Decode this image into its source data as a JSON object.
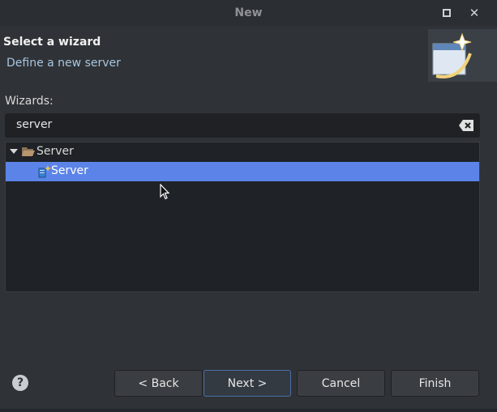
{
  "window": {
    "title": "New"
  },
  "header": {
    "heading": "Select a wizard",
    "subtitle": "Define a new server"
  },
  "wizards": {
    "label": "Wizards:",
    "search_value": "server",
    "tree": [
      {
        "label": "Server",
        "type": "folder",
        "expanded": true
      },
      {
        "label": "Server",
        "type": "server",
        "selected": true
      }
    ]
  },
  "buttons": {
    "back": "< Back",
    "next": "Next >",
    "cancel": "Cancel",
    "finish": "Finish"
  },
  "help": {
    "glyph": "?"
  },
  "colors": {
    "background": "#2f3236",
    "selection": "#5c84e8",
    "subtitle": "#a8c6e0"
  }
}
